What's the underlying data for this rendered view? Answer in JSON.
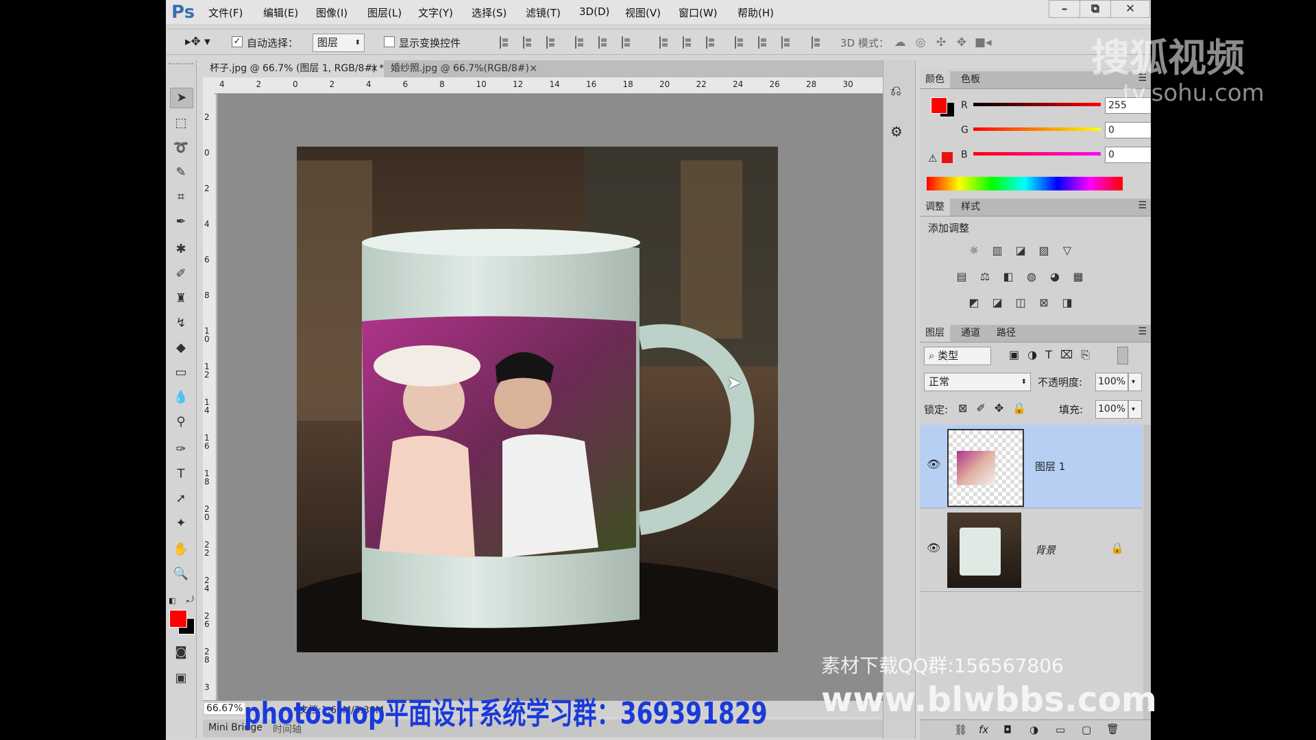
{
  "app": {
    "logo": "Ps",
    "menu": [
      "文件(F)",
      "编辑(E)",
      "图像(I)",
      "图层(L)",
      "文字(Y)",
      "选择(S)",
      "滤镜(T)",
      "3D(D)",
      "视图(V)",
      "窗口(W)",
      "帮助(H)"
    ],
    "window_buttons": [
      "–",
      "⧉",
      "✕"
    ]
  },
  "options": {
    "auto_select_label": "自动选择：",
    "auto_select_checked": "✓",
    "auto_select_value": "图层",
    "show_transform_label": "显示变换控件",
    "mode3d_label": "3D 模式："
  },
  "tabs": [
    {
      "label": "杯子.jpg @ 66.7% (图层 1, RGB/8#) *",
      "close": "×"
    },
    {
      "label": "婚纱照.jpg @ 66.7%(RGB/8#)",
      "close": "×"
    }
  ],
  "ruler": {
    "h": [
      "4",
      "2",
      "0",
      "2",
      "4",
      "6",
      "8",
      "10",
      "12",
      "14",
      "16",
      "18",
      "20",
      "22",
      "24",
      "26",
      "28",
      "30"
    ],
    "v": [
      "2",
      "0",
      "2",
      "4",
      "6",
      "8",
      "1 0",
      "1 2",
      "1 4",
      "1 6",
      "1 8",
      "2 0",
      "2 2",
      "2 4",
      "2 6",
      "2 8",
      "3"
    ]
  },
  "status": {
    "zoom": "66.67%",
    "doc": "文档:1.69M/3.38M"
  },
  "bottom_tabs": [
    "Mini Bridge",
    "时间轴"
  ],
  "color_panel": {
    "tabs": [
      "颜色",
      "色板"
    ],
    "channels": [
      {
        "name": "R",
        "value": "255"
      },
      {
        "name": "G",
        "value": "0"
      },
      {
        "name": "B",
        "value": "0"
      }
    ],
    "foreground": "#ff0000",
    "background": "#000000"
  },
  "adjust_panel": {
    "tabs": [
      "调整",
      "样式"
    ],
    "title": "添加调整",
    "row1": [
      "☼",
      "▥",
      "◪",
      "▨",
      "▽"
    ],
    "row2": [
      "▤",
      "⚖",
      "◧",
      "◍",
      "◕",
      "▦"
    ],
    "row3": [
      "◩",
      "◪",
      "◫",
      "⊠",
      "◨"
    ]
  },
  "layers_panel": {
    "tabs": [
      "图层",
      "通道",
      "路径"
    ],
    "filter_label": "类型",
    "blend_mode": "正常",
    "opacity_label": "不透明度:",
    "opacity_value": "100%",
    "lock_label": "锁定:",
    "fill_label": "填充:",
    "fill_value": "100%",
    "layers": [
      {
        "name": "图层 1",
        "selected": true
      },
      {
        "name": "背景",
        "locked": true
      }
    ],
    "footer_icons": [
      "⛓",
      "fx",
      "◘",
      "◑",
      "▭",
      "▢",
      "🗑"
    ]
  },
  "overlays": {
    "sohu_cn": "搜狐视频",
    "sohu_url": "tv.sohu.com",
    "qq_group": "素材下载QQ群:156567806",
    "site": "www.blwbbs.com",
    "study_group": "photoshop平面设计系统学习群：369391829"
  },
  "colors": {
    "selected_layer": "#b7cff3",
    "accent": "#ff0000",
    "study_group_text": "#1a3ad9"
  }
}
